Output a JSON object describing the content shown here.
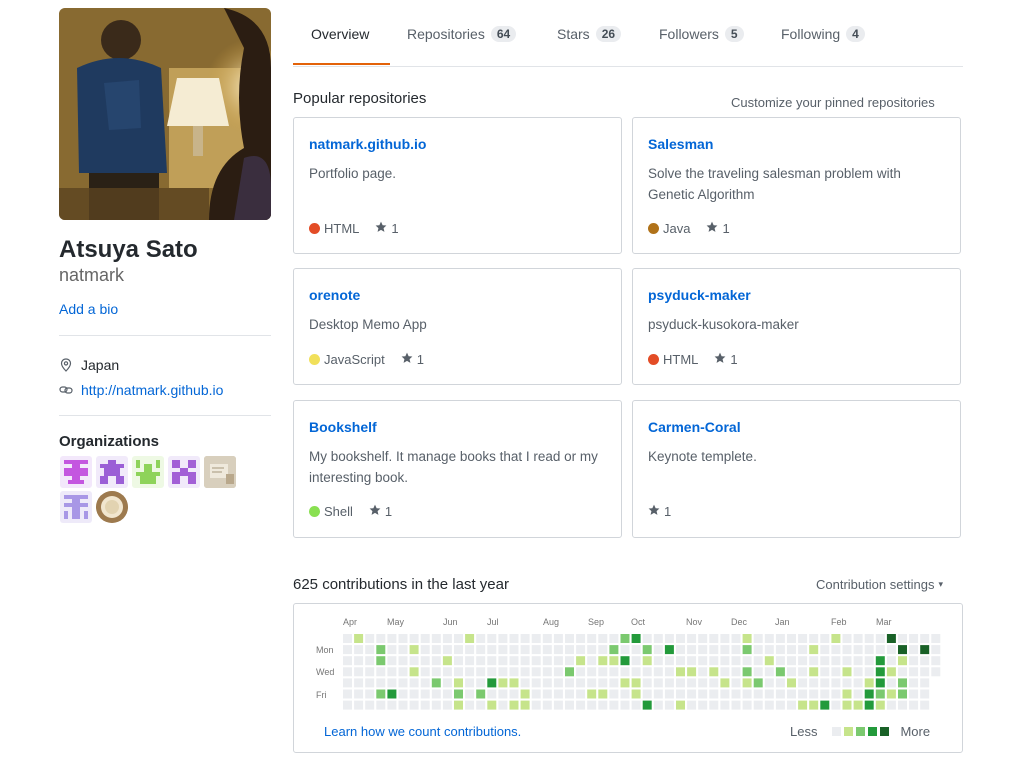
{
  "profile": {
    "full_name": "Atsuya Sato",
    "username": "natmark",
    "add_bio_label": "Add a bio",
    "location": "Japan",
    "website": "http://natmark.github.io"
  },
  "organizations": {
    "title": "Organizations",
    "items": [
      {
        "icon": "org-avatar-magenta-1"
      },
      {
        "icon": "org-avatar-purple-2"
      },
      {
        "icon": "org-avatar-green-3"
      },
      {
        "icon": "org-avatar-purple-4"
      },
      {
        "icon": "org-avatar-photo-5"
      },
      {
        "icon": "org-avatar-lavender-6"
      },
      {
        "icon": "org-avatar-photo-7"
      }
    ]
  },
  "tabs": [
    {
      "label": "Overview",
      "count": null,
      "active": true
    },
    {
      "label": "Repositories",
      "count": "64"
    },
    {
      "label": "Stars",
      "count": "26"
    },
    {
      "label": "Followers",
      "count": "5"
    },
    {
      "label": "Following",
      "count": "4"
    }
  ],
  "pinned": {
    "title": "Popular repositories",
    "customize_label": "Customize your pinned repositories",
    "repos": [
      {
        "name": "natmark.github.io",
        "description": "Portfolio page.",
        "language": "HTML",
        "language_color": "#e34c26",
        "stars": "1"
      },
      {
        "name": "Salesman",
        "description": "Solve the traveling salesman problem with Genetic Algorithm",
        "language": "Java",
        "language_color": "#b07219",
        "stars": "1"
      },
      {
        "name": "orenote",
        "description": "Desktop Memo App",
        "language": "JavaScript",
        "language_color": "#f1e05a",
        "stars": "1"
      },
      {
        "name": "psyduck-maker",
        "description": "psyduck-kusokora-maker",
        "language": "HTML",
        "language_color": "#e34c26",
        "stars": "1"
      },
      {
        "name": "Bookshelf",
        "description": "My bookshelf. It manage books that I read or my interesting book.",
        "language": "Shell",
        "language_color": "#89e051",
        "stars": "1"
      },
      {
        "name": "Carmen-Coral",
        "description": "Keynote templete.",
        "language": "",
        "language_color": "",
        "stars": "1"
      }
    ]
  },
  "contributions": {
    "title": "625 contributions in the last year",
    "settings_label": "Contribution settings",
    "months": [
      "Apr",
      "May",
      "Jun",
      "Jul",
      "Aug",
      "Sep",
      "Oct",
      "Nov",
      "Dec",
      "Jan",
      "Feb",
      "Mar"
    ],
    "day_labels": [
      "Mon",
      "Wed",
      "Fri"
    ],
    "learn_label": "Learn how we count contributions.",
    "legend_less": "Less",
    "legend_more": "More",
    "colors": [
      "#ebedf0",
      "#c6e48b",
      "#7bc96f",
      "#239a3b",
      "#196127"
    ]
  }
}
